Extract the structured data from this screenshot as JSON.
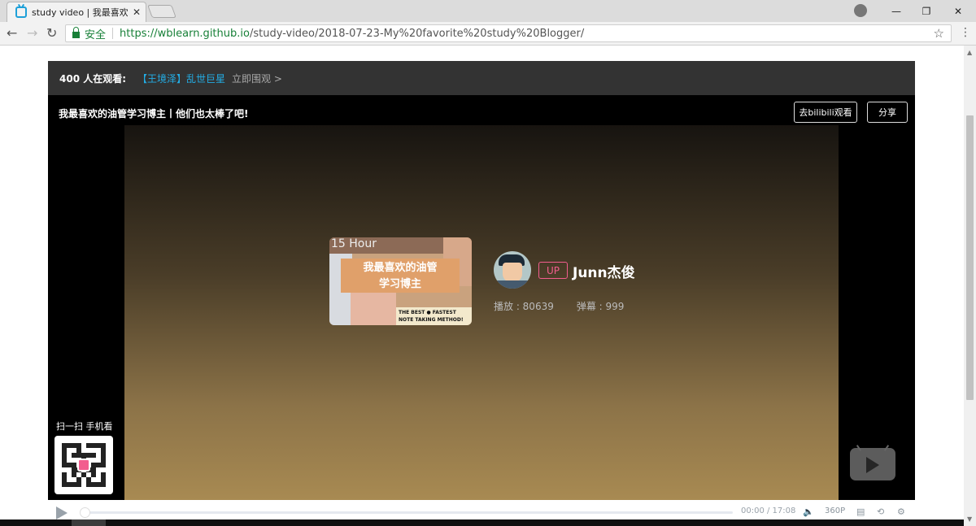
{
  "browser": {
    "tab_title": "study video | 我最喜欢的",
    "tab_close": "✕",
    "security_label": "安全",
    "url_host": "https://wblearn.github.io",
    "url_path": "/study-video/2018-07-23-My%20favorite%20study%20Blogger/",
    "window_controls": [
      "—",
      "❐",
      "✕"
    ]
  },
  "player": {
    "watching": "400 人在观看:",
    "hot_video_link": "【王境泽】乱世巨星",
    "hot_video_go": "立即围观 >",
    "video_title": "我最喜欢的油管学习博主丨他们也太棒了吧!",
    "open_bilibili": "去bilibili观看",
    "share": "分享",
    "cover": {
      "top_text": "15 Hour",
      "banner_line1": "我最喜欢的油管",
      "banner_line2": "学习博主",
      "strip_line1": "THE BEST ● FASTEST",
      "strip_line2": "NOTE TAKING METHOD!"
    },
    "uploader": {
      "badge": "UP",
      "name": "Junn杰俊"
    },
    "stats": {
      "plays": "播放 : 80639",
      "danmaku": "弹幕 : 999"
    },
    "qr_label": "扫一扫 手机看",
    "time": "00:00 / 17:08",
    "quality": "360P"
  },
  "icons": {
    "play": "play-icon",
    "volume": "volume-icon",
    "danmaku": "danmaku-icon",
    "loop": "loop-icon",
    "settings": "settings-icon",
    "tv": "tv-icon"
  },
  "colors": {
    "bilibili_pink": "#f25d8e",
    "bilibili_blue": "#23ade5",
    "secure_green": "#188038"
  }
}
